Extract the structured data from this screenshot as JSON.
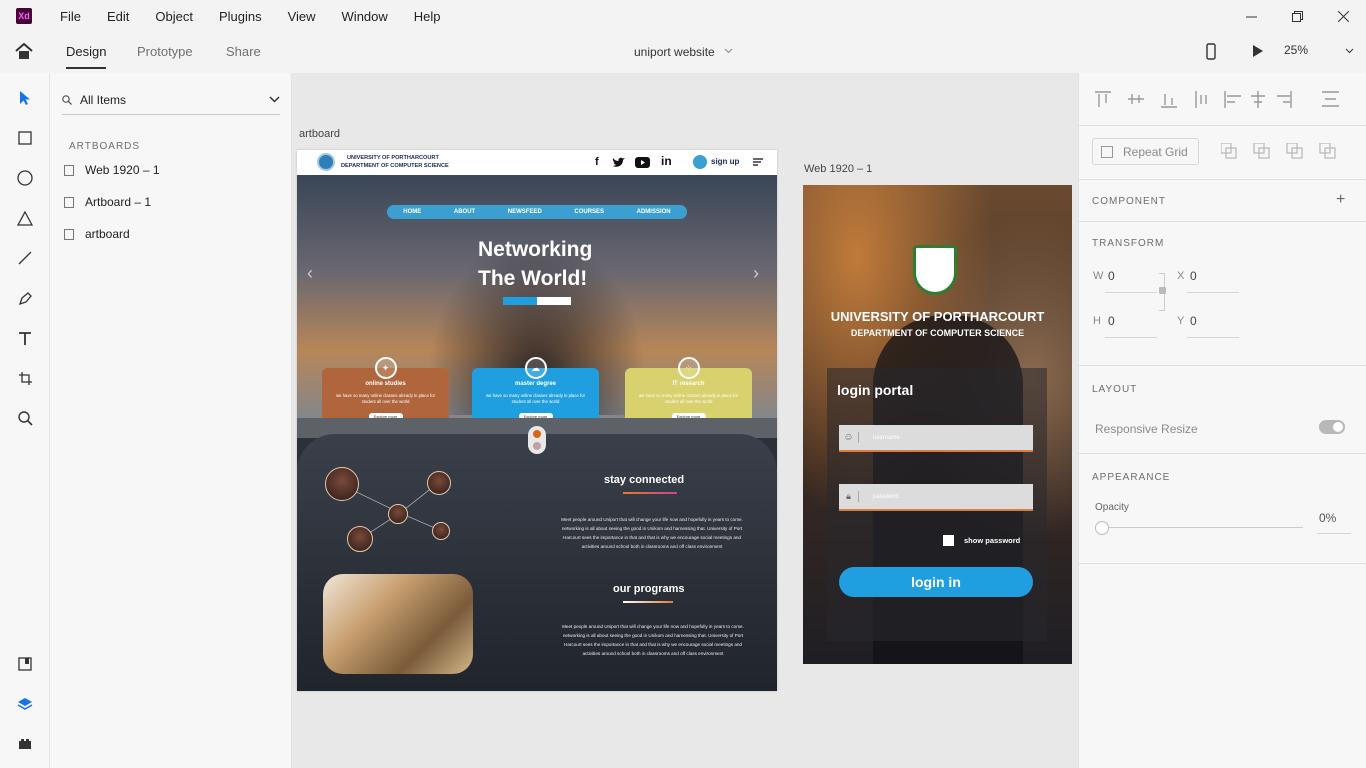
{
  "app": {
    "logo": "Xd",
    "menu": [
      "File",
      "Edit",
      "Object",
      "Plugins",
      "View",
      "Window",
      "Help"
    ],
    "window_controls": [
      "minimize-icon",
      "restore-icon",
      "close-icon"
    ]
  },
  "toolbar": {
    "tabs": [
      "Design",
      "Prototype",
      "Share"
    ],
    "active_tab": "Design",
    "document_title": "uniport website",
    "zoom": "25%"
  },
  "layers": {
    "search_label": "All Items",
    "section": "ARTBOARDS",
    "items": [
      "Web 1920 – 1",
      "Artboard – 1",
      "artboard"
    ]
  },
  "canvas": {
    "artboard_label": "artboard",
    "web_label": "Web 1920 – 1",
    "website": {
      "uni_line1": "UNIVERSITY OF PORTHARCOURT",
      "uni_line2": "DEPARTMENT OF COMPUTER SCIENCE",
      "signup": "sign up",
      "nav": [
        "HOME",
        "ABOUT",
        "NEWSFEED",
        "COURSES",
        "ADMISSION"
      ],
      "hero_line1": "Networking",
      "hero_line2": "The World!",
      "cards": [
        {
          "title": "online studies",
          "desc": "we have so many online classes already in place for student all over the world",
          "button": "Explore more",
          "color": "#b0653c"
        },
        {
          "title": "master degree",
          "desc": "we have so many online classes already in place for student all over the world",
          "button": "Explore more",
          "color": "#1f9fe0"
        },
        {
          "title": "IT research",
          "desc": "we have so many online classes already in place for student all over the world",
          "button": "Explore more",
          "color": "#d8d16d"
        }
      ],
      "stay_title": "stay connected",
      "stay_text": "Meet people around Uniport that will change your life now and hopefully in years to come. networking is all about seeing the good in Unikom and harnessing that. University of Port Harcourt sees the importance in that and that is why we encourage social meetings and activities around school both in classrooms and off class environment",
      "programs_title": "our programs",
      "programs_text": "Meet people around Uniport that will change your life now and hopefully in years to come. networking is all about seeing the good in Unikom and harnessing that. University of Port Harcourt sees the importance in that and that is why we encourage social meetings and activities around school both in classrooms and off class environment"
    },
    "login": {
      "uni_line1": "UNIVERSITY OF PORTHARCOURT",
      "uni_line2": "DEPARTMENT OF COMPUTER SCIENCE",
      "portal_title": "login portal",
      "username_placeholder": "username",
      "password_placeholder": "password",
      "show_password": "show password",
      "login_button": "login in"
    }
  },
  "props": {
    "repeat_grid": "Repeat Grid",
    "component": "COMPONENT",
    "transform": "TRANSFORM",
    "w_label": "W",
    "w_value": "0",
    "x_label": "X",
    "x_value": "0",
    "h_label": "H",
    "h_value": "0",
    "y_label": "Y",
    "y_value": "0",
    "layout": "LAYOUT",
    "responsive_resize": "Responsive Resize",
    "appearance": "APPEARANCE",
    "opacity_label": "Opacity",
    "opacity_value": "0%"
  },
  "colors": {
    "accent": "#1f9fe0",
    "xd_purple": "#470137",
    "orange": "#e07b3a"
  }
}
